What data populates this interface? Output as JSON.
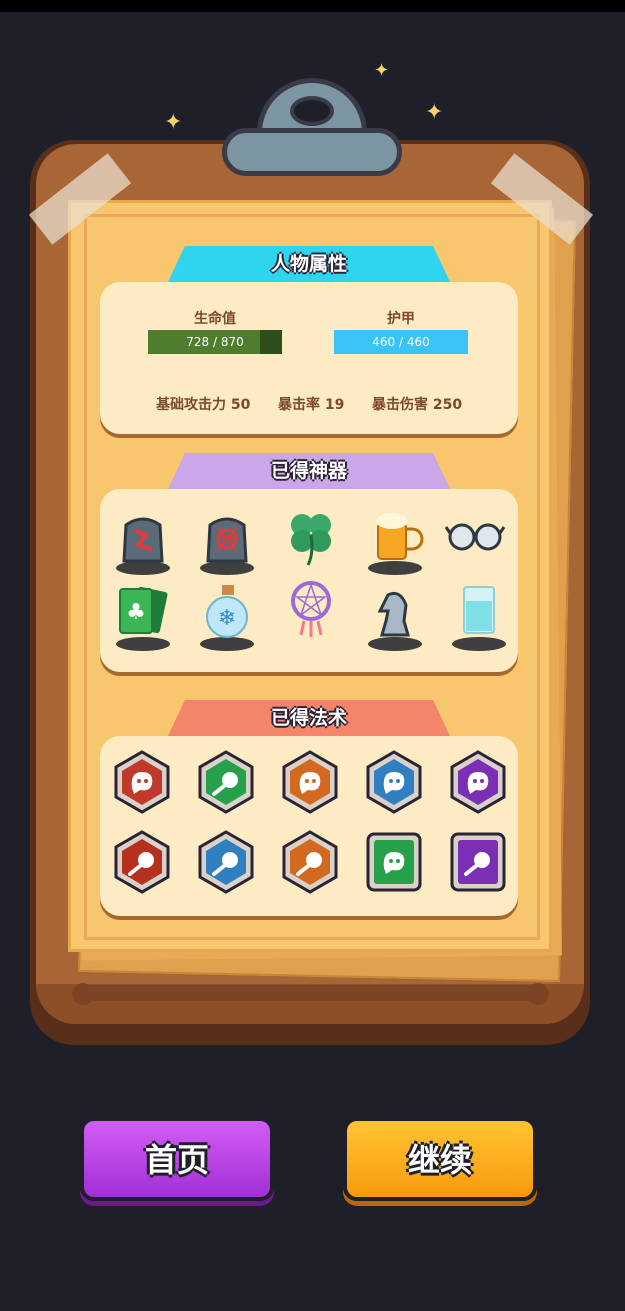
{
  "character": {
    "header": "人物属性",
    "hp_label": "生命值",
    "hp_value": "728 / 870",
    "hp_fraction": 0.837,
    "armor_label": "护甲",
    "armor_value": "460 / 460",
    "armor_fraction": 1.0,
    "base_attack": "基础攻击力 50",
    "crit_rate": "暴击率 19",
    "crit_damage": "暴击伤害 250"
  },
  "artifacts": {
    "header": "已得神器",
    "items": [
      {
        "icon": "red-rune-stone-icon"
      },
      {
        "icon": "skull-rune-stone-icon"
      },
      {
        "icon": "four-leaf-clover-icon"
      },
      {
        "icon": "beer-mug-icon"
      },
      {
        "icon": "glasses-icon"
      },
      {
        "icon": "club-card-icon"
      },
      {
        "icon": "snowflake-potion-icon"
      },
      {
        "icon": "dreamcatcher-icon"
      },
      {
        "icon": "chess-knight-icon"
      },
      {
        "icon": "water-glass-icon"
      }
    ]
  },
  "spells": {
    "header": "已得法术",
    "items": [
      {
        "icon": "ghost-spell-icon",
        "color": "#c0392b",
        "shape": "hex"
      },
      {
        "icon": "comet-spell-icon",
        "color": "#27a04a",
        "shape": "hex"
      },
      {
        "icon": "ghost-spell-icon",
        "color": "#d2691e",
        "shape": "hex"
      },
      {
        "icon": "ghost-spell-icon",
        "color": "#2f7fc1",
        "shape": "hex"
      },
      {
        "icon": "ghost-spell-icon",
        "color": "#7b2fb5",
        "shape": "hex"
      },
      {
        "icon": "comet-spell-icon",
        "color": "#b5301f",
        "shape": "hex"
      },
      {
        "icon": "comet-spell-icon",
        "color": "#2f7fc1",
        "shape": "hex"
      },
      {
        "icon": "comet-spell-icon",
        "color": "#d2691e",
        "shape": "hex"
      },
      {
        "icon": "ghost-spell-icon",
        "color": "#27a04a",
        "shape": "square"
      },
      {
        "icon": "comet-spell-icon",
        "color": "#7b2fb5",
        "shape": "square"
      }
    ]
  },
  "buttons": {
    "home": "首页",
    "continue": "继续"
  },
  "colors": {
    "hp_bar": "#4f7d2d",
    "armor_bar": "#3cc3f5",
    "character_header": "#2fd4ef",
    "artifacts_header": "#c9a7e8",
    "spells_header": "#f2856a",
    "home_button": "#b43ee0",
    "continue_button": "#fbaa12"
  }
}
